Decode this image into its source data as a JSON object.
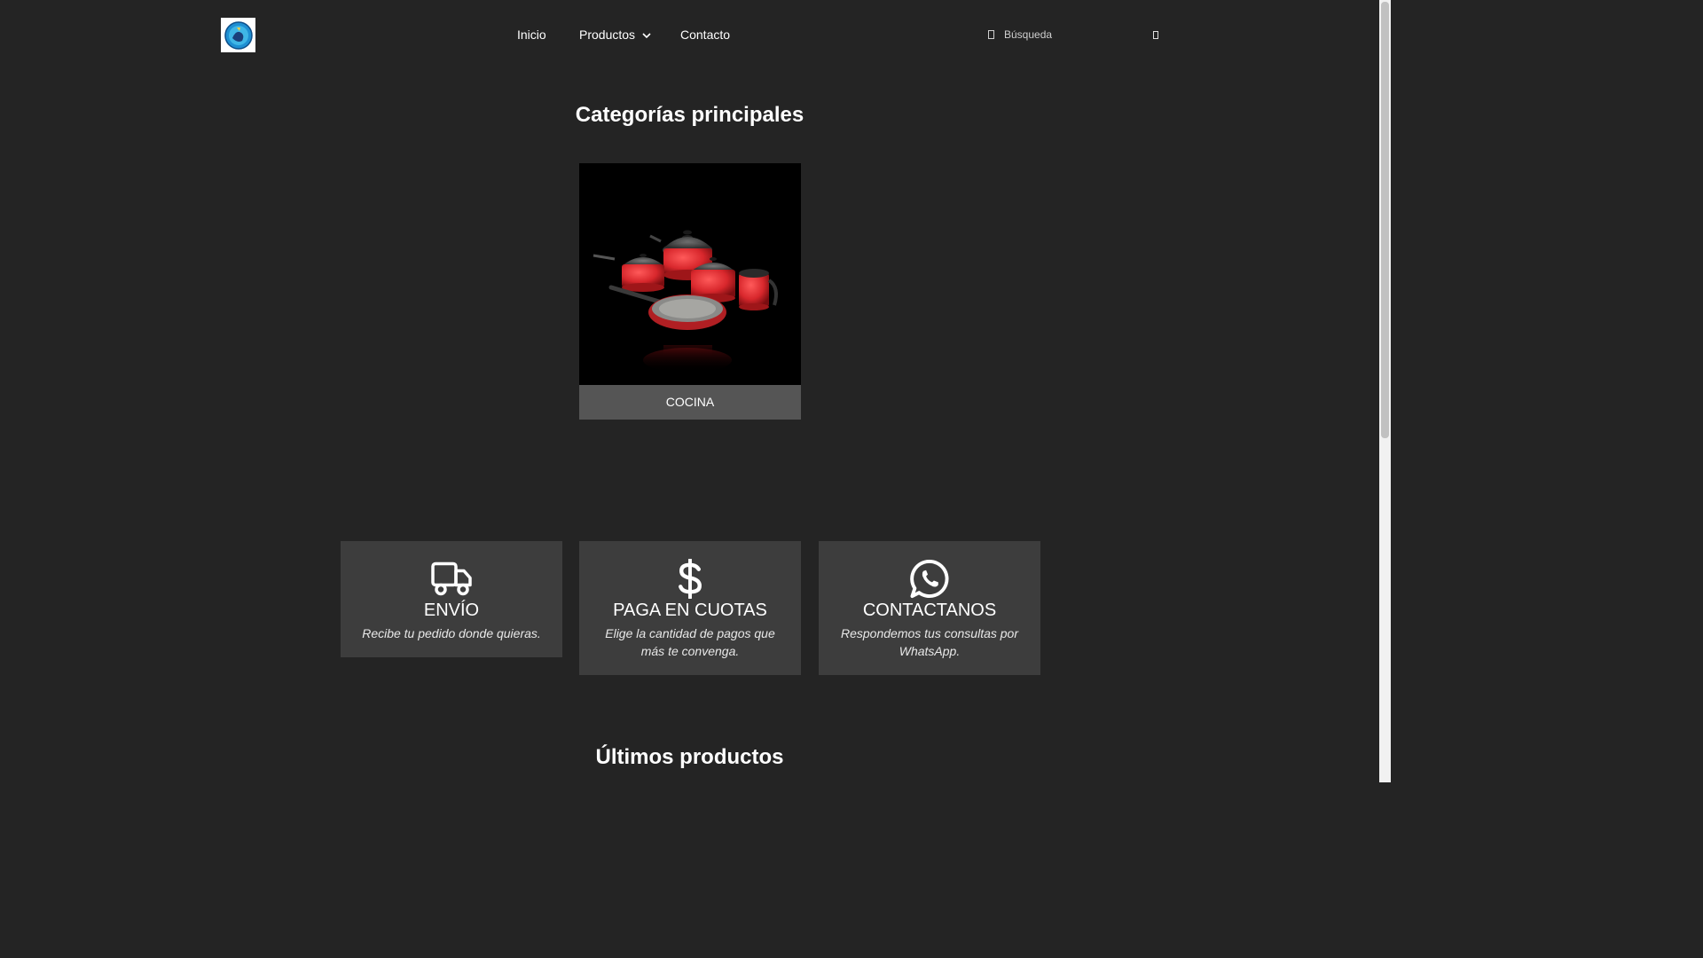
{
  "header": {
    "logo_alt": "Logo",
    "nav": {
      "inicio": "Inicio",
      "productos": "Productos",
      "contacto": "Contacto"
    },
    "search": {
      "placeholder": "Búsqueda",
      "value": ""
    }
  },
  "categories_section": {
    "title": "Categorías principales",
    "items": [
      {
        "label": "COCINA",
        "image": "red-cookware-set"
      }
    ]
  },
  "features": [
    {
      "icon": "truck-icon",
      "title": "ENVÍO",
      "text": "Recibe tu pedido donde quieras."
    },
    {
      "icon": "dollar-icon",
      "title": "PAGA EN CUOTAS",
      "text": "Elige la cantidad de pagos que más te convenga."
    },
    {
      "icon": "whatsapp-icon",
      "title": "CONTACTANOS",
      "text": "Respondemos tus consultas por WhatsApp."
    }
  ],
  "latest_section": {
    "title": "Últimos productos"
  },
  "colors": {
    "background": "#242424",
    "feature_box": "#3d3d3d",
    "category_label_bg": "#555555",
    "cookware_red": "#d8272c"
  }
}
